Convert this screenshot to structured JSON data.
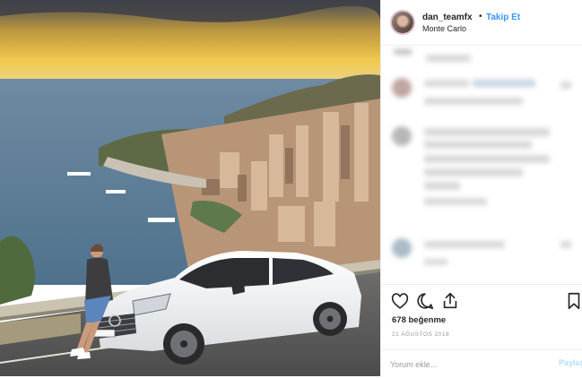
{
  "header": {
    "username": "dan_teamfx",
    "separator": "•",
    "follow_label": "Takip Et",
    "location": "Monte Carlo",
    "more_label": "•••"
  },
  "post": {
    "likes": "678 beğenme",
    "date": "21 AĞUSTOS 2018"
  },
  "comment": {
    "placeholder": "Yorum ekle...",
    "post_label": "Paylaş"
  },
  "colors": {
    "link_blue": "#3897f0",
    "post_button_disabled": "#b2dffc",
    "text": "#262626",
    "muted": "#999999"
  },
  "icons": [
    "heart-icon",
    "comment-icon",
    "share-icon",
    "bookmark-icon",
    "more-options-icon"
  ]
}
